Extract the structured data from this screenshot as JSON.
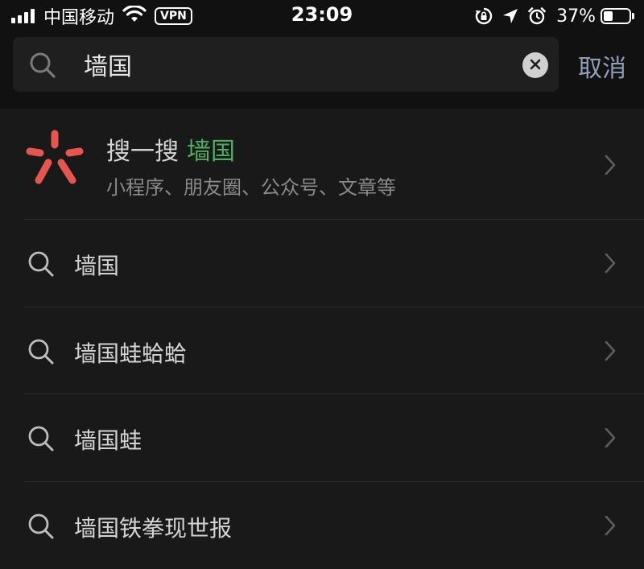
{
  "status_bar": {
    "carrier": "中国移动",
    "vpn": "VPN",
    "time": "23:09",
    "battery_percent": "37%",
    "battery_level": 0.37,
    "icons": [
      "signal-icon",
      "wifi-icon",
      "rotation-lock-icon",
      "location-icon",
      "alarm-icon",
      "battery-icon"
    ]
  },
  "search": {
    "query": "墙国",
    "cancel_label": "取消"
  },
  "sousou": {
    "title": "搜一搜",
    "keyword": "墙国",
    "subtitle": "小程序、朋友圈、公众号、文章等",
    "logo_color": "#e8554f"
  },
  "suggestions": [
    {
      "text": "墙国"
    },
    {
      "text": "墙国蛙蛤蛤"
    },
    {
      "text": "墙国蛙"
    },
    {
      "text": "墙国铁拳现世报"
    }
  ],
  "colors": {
    "background": "#191919",
    "header": "#111111",
    "keyword_green": "#4caf64",
    "cancel_blue": "#8ea0b8"
  }
}
